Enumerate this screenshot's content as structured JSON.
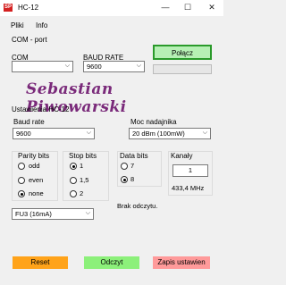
{
  "window": {
    "title": "HC-12",
    "icon_text": "SP",
    "min_glyph": "—",
    "max_glyph": "☐",
    "close_glyph": "✕"
  },
  "menu": {
    "items": [
      "Pliki",
      "Info"
    ]
  },
  "com_port": {
    "group_label": "COM - port",
    "com_label": "COM",
    "com_value": "",
    "baud_label": "BAUD RATE",
    "baud_value": "9600",
    "connect_button": "Połącz",
    "status_bar_progress": 0
  },
  "banner": {
    "text": "Sebastian Piwowarski"
  },
  "settings": {
    "group_label": "Ustawienia HC-12",
    "baud_label": "Baud rate",
    "baud_value": "9600",
    "power_label": "Moc nadajnika",
    "power_value": "20 dBm (100mW)",
    "parity": {
      "label": "Parity bits",
      "options": [
        "odd",
        "even",
        "none"
      ],
      "selected": "none"
    },
    "stop": {
      "label": "Stop bits",
      "options": [
        "1",
        "1,5",
        "2"
      ],
      "selected": "1"
    },
    "data": {
      "label": "Data bits",
      "options": [
        "7",
        "8"
      ],
      "selected": "8"
    },
    "channel": {
      "label": "Kanały",
      "value": "1",
      "frequency": "433,4 MHz"
    },
    "mode_value": "FU3 (16mA)",
    "status_text": "Brak odczytu."
  },
  "buttons": {
    "reset": "Reset",
    "read": "Odczyt",
    "save": "Zapis ustawien"
  },
  "colors": {
    "accent_green": "#b6f0b4",
    "reset_orange": "#ffa31a",
    "read_green": "#8cf07a",
    "save_red": "#ff9a9a",
    "banner_purple": "#7a2a7a"
  }
}
